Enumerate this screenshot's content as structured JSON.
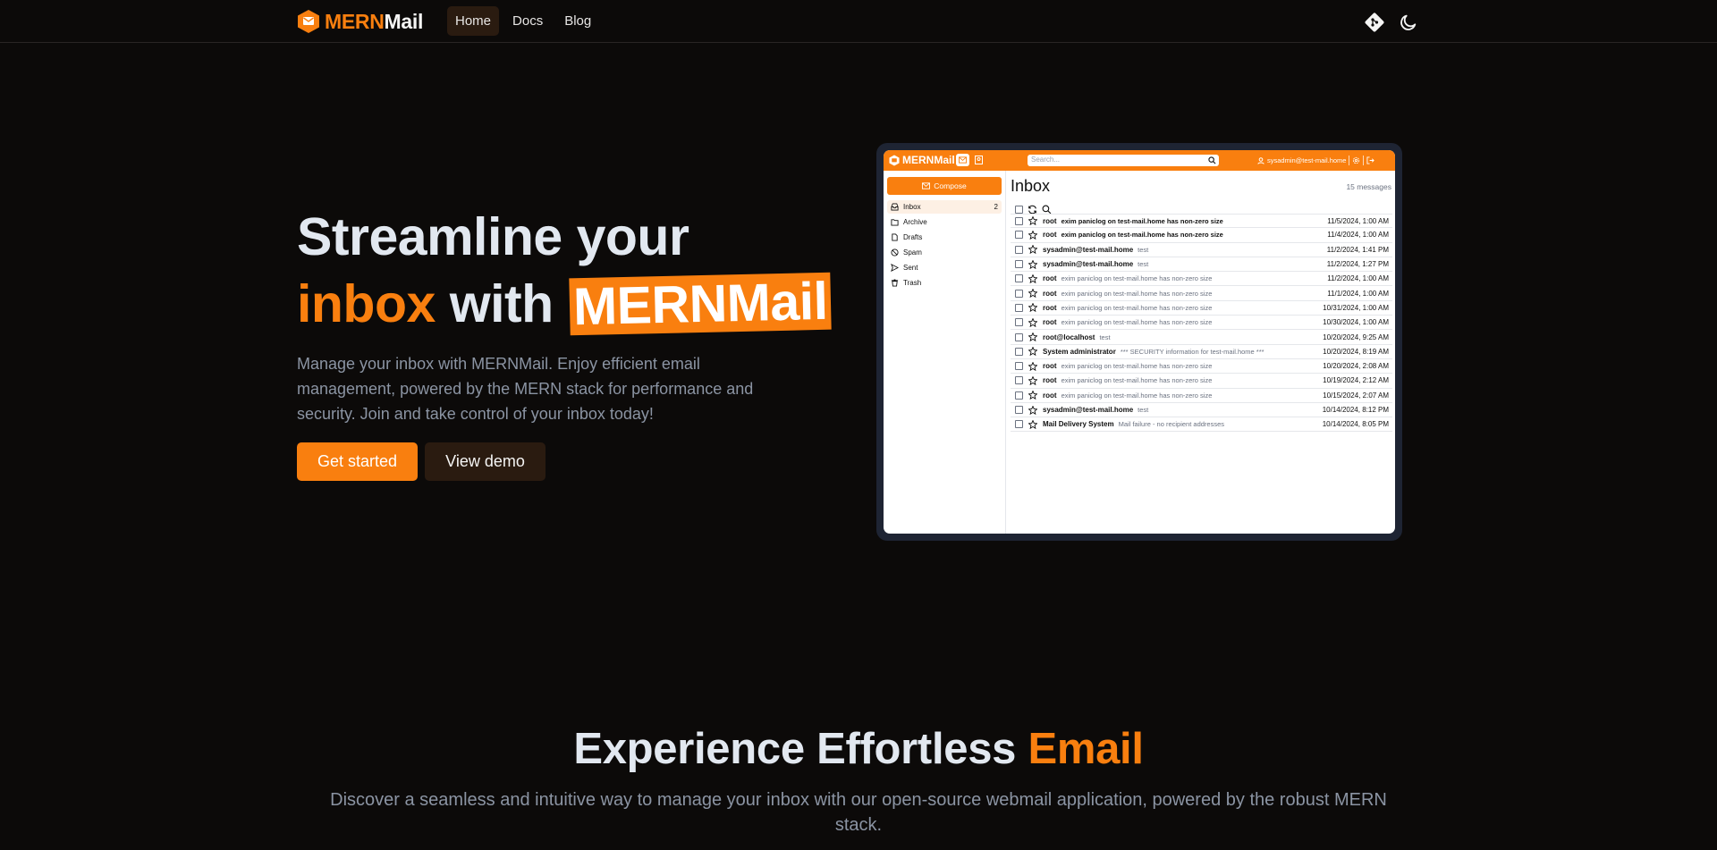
{
  "nav": {
    "brand_mern": "MERN",
    "brand_mail": "Mail",
    "links": [
      {
        "label": "Home",
        "active": true
      },
      {
        "label": "Docs",
        "active": false
      },
      {
        "label": "Blog",
        "active": false
      }
    ],
    "icons": [
      "git-icon",
      "moon-icon"
    ]
  },
  "hero": {
    "line1": "Streamline your",
    "orange_word": "inbox",
    "with": "with",
    "badge": "MERNMail",
    "description": "Manage your inbox with MERNMail. Enjoy efficient email management, powered by the MERN stack for performance and security. Join and take control of your inbox today!",
    "primary_button": "Get started",
    "secondary_button": "View demo"
  },
  "preview": {
    "brand": "MERNMail",
    "search_placeholder": "Search...",
    "user": "sysadmin@test-mail.home",
    "compose": "Compose",
    "folders": [
      {
        "label": "Inbox",
        "count": "2",
        "icon": "inbox-icon",
        "active": true
      },
      {
        "label": "Archive",
        "count": "",
        "icon": "archive-icon",
        "active": false
      },
      {
        "label": "Drafts",
        "count": "",
        "icon": "drafts-icon",
        "active": false
      },
      {
        "label": "Spam",
        "count": "",
        "icon": "spam-icon",
        "active": false
      },
      {
        "label": "Sent",
        "count": "",
        "icon": "sent-icon",
        "active": false
      },
      {
        "label": "Trash",
        "count": "",
        "icon": "trash-icon",
        "active": false
      }
    ],
    "title": "Inbox",
    "message_count": "15 messages",
    "messages": [
      {
        "sender": "root",
        "subject": "exim paniclog on test-mail.home has non-zero size",
        "date": "11/5/2024, 1:00 AM",
        "unread": true
      },
      {
        "sender": "root",
        "subject": "exim paniclog on test-mail.home has non-zero size",
        "date": "11/4/2024, 1:00 AM",
        "unread": true
      },
      {
        "sender": "sysadmin@test-mail.home",
        "subject": "test",
        "date": "11/2/2024, 1:41 PM",
        "unread": false
      },
      {
        "sender": "sysadmin@test-mail.home",
        "subject": "test",
        "date": "11/2/2024, 1:27 PM",
        "unread": false
      },
      {
        "sender": "root",
        "subject": "exim paniclog on test-mail.home has non-zero size",
        "date": "11/2/2024, 1:00 AM",
        "unread": false
      },
      {
        "sender": "root",
        "subject": "exim paniclog on test-mail.home has non-zero size",
        "date": "11/1/2024, 1:00 AM",
        "unread": false
      },
      {
        "sender": "root",
        "subject": "exim paniclog on test-mail.home has non-zero size",
        "date": "10/31/2024, 1:00 AM",
        "unread": false
      },
      {
        "sender": "root",
        "subject": "exim paniclog on test-mail.home has non-zero size",
        "date": "10/30/2024, 1:00 AM",
        "unread": false
      },
      {
        "sender": "root@localhost",
        "subject": "test",
        "date": "10/20/2024, 9:25 AM",
        "unread": false
      },
      {
        "sender": "System administrator",
        "subject": "*** SECURITY information for test-mail.home ***",
        "date": "10/20/2024, 8:19 AM",
        "unread": false
      },
      {
        "sender": "root",
        "subject": "exim paniclog on test-mail.home has non-zero size",
        "date": "10/20/2024, 2:08 AM",
        "unread": false
      },
      {
        "sender": "root",
        "subject": "exim paniclog on test-mail.home has non-zero size",
        "date": "10/19/2024, 2:12 AM",
        "unread": false
      },
      {
        "sender": "root",
        "subject": "exim paniclog on test-mail.home has non-zero size",
        "date": "10/15/2024, 2:07 AM",
        "unread": false
      },
      {
        "sender": "sysadmin@test-mail.home",
        "subject": "test",
        "date": "10/14/2024, 8:12 PM",
        "unread": false
      },
      {
        "sender": "Mail Delivery System",
        "subject": "Mail failure - no recipient addresses",
        "date": "10/14/2024, 8:05 PM",
        "unread": false
      }
    ]
  },
  "section2": {
    "title_main": "Experience Effortless",
    "title_orange": "Email",
    "description": "Discover a seamless and intuitive way to manage your inbox with our open-source webmail application, powered by the robust MERN stack."
  },
  "colors": {
    "background": "#0c0a09",
    "accent": "#f97f0f",
    "muted_text": "#8b94a3"
  }
}
